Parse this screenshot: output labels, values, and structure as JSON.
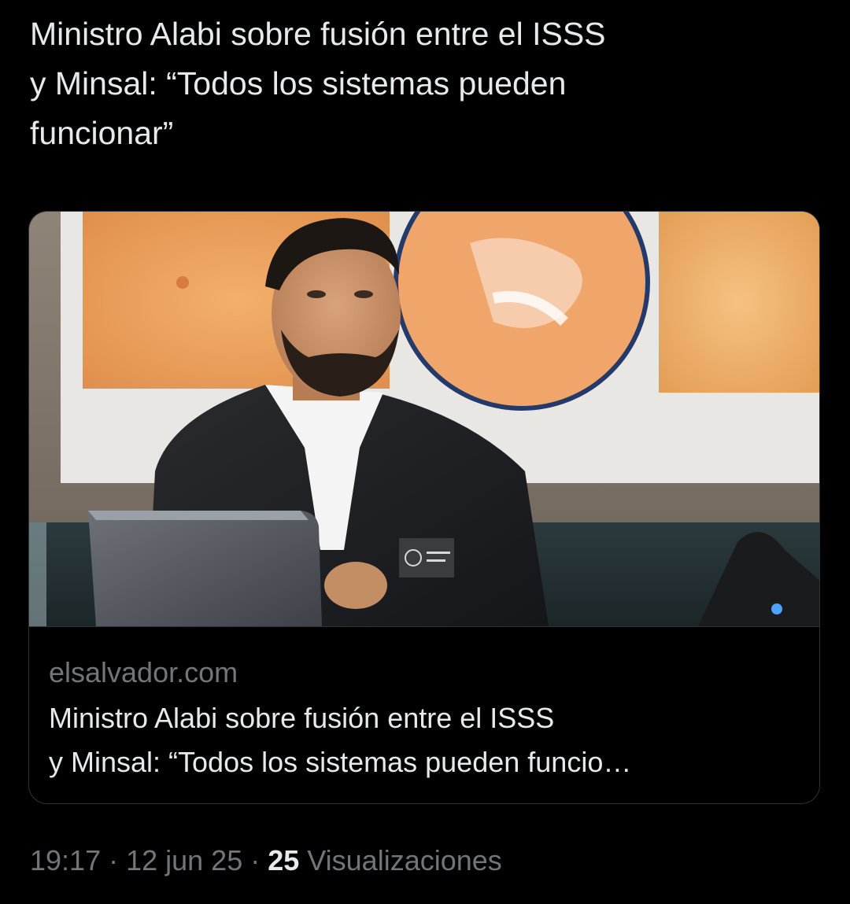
{
  "tweet": {
    "text_lines": [
      "Ministro Alabi sobre fusión entre el ISSS",
      "y Minsal: “Todos los sistemas pueden",
      "funcionar”"
    ]
  },
  "card": {
    "domain": "elsalvador.com",
    "title_line1": "Ministro Alabi sobre fusión entre el ISSS",
    "title_line2": "y Minsal: “Todos los sistemas pueden funcio…"
  },
  "meta": {
    "time": "19:17",
    "separator": "·",
    "date": "12 jun 25",
    "views_count": "25",
    "views_label": "Visualizaciones"
  },
  "colors": {
    "background": "#000000",
    "primary_text": "#e7e9ea",
    "secondary_text": "#71767b",
    "border": "#2f3336"
  }
}
